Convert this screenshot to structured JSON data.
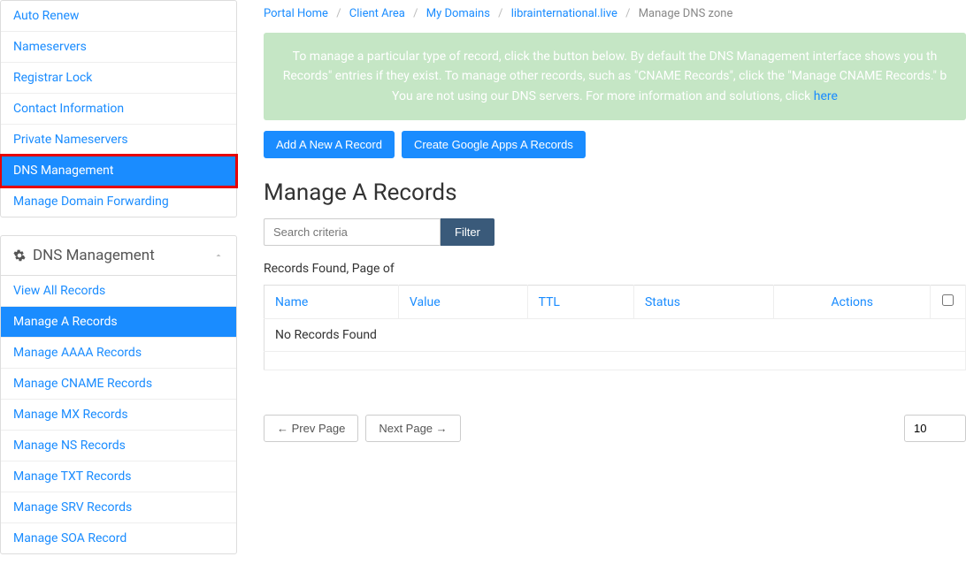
{
  "sidebar_top": {
    "items": [
      {
        "label": "Auto Renew"
      },
      {
        "label": "Nameservers"
      },
      {
        "label": "Registrar Lock"
      },
      {
        "label": "Contact Information"
      },
      {
        "label": "Private Nameservers"
      },
      {
        "label": "DNS Management"
      },
      {
        "label": "Manage Domain Forwarding"
      }
    ]
  },
  "sidebar_dns": {
    "title": "DNS Management",
    "items": [
      {
        "label": "View All Records"
      },
      {
        "label": "Manage A Records"
      },
      {
        "label": "Manage AAAA Records"
      },
      {
        "label": "Manage CNAME Records"
      },
      {
        "label": "Manage MX Records"
      },
      {
        "label": "Manage NS Records"
      },
      {
        "label": "Manage TXT Records"
      },
      {
        "label": "Manage SRV Records"
      },
      {
        "label": "Manage SOA Record"
      }
    ]
  },
  "breadcrumb": {
    "items": [
      {
        "label": "Portal Home"
      },
      {
        "label": "Client Area"
      },
      {
        "label": "My Domains"
      },
      {
        "label": "librainternational.live"
      }
    ],
    "current": "Manage DNS zone"
  },
  "alert": {
    "line1": "To manage a particular type of record, click the button below. By default the DNS Management interface shows you th",
    "line2": "Records\" entries if they exist. To manage other records, such as \"CNAME Records\", click the \"Manage CNAME Records.\" b",
    "line3_prefix": "You are not using our DNS servers. For more information and solutions, click ",
    "line3_link": "here"
  },
  "buttons": {
    "add_record": "Add A New A Record",
    "google_apps": "Create Google Apps A Records"
  },
  "heading": "Manage A Records",
  "filter": {
    "placeholder": "Search criteria",
    "button": "Filter"
  },
  "records_meta": "Records Found, Page of",
  "table": {
    "headers": {
      "name": "Name",
      "value": "Value",
      "ttl": "TTL",
      "status": "Status",
      "actions": "Actions"
    },
    "empty": "No Records Found"
  },
  "pagination": {
    "prev": "← Prev Page",
    "next": "Next Page →",
    "page_size": "10"
  }
}
